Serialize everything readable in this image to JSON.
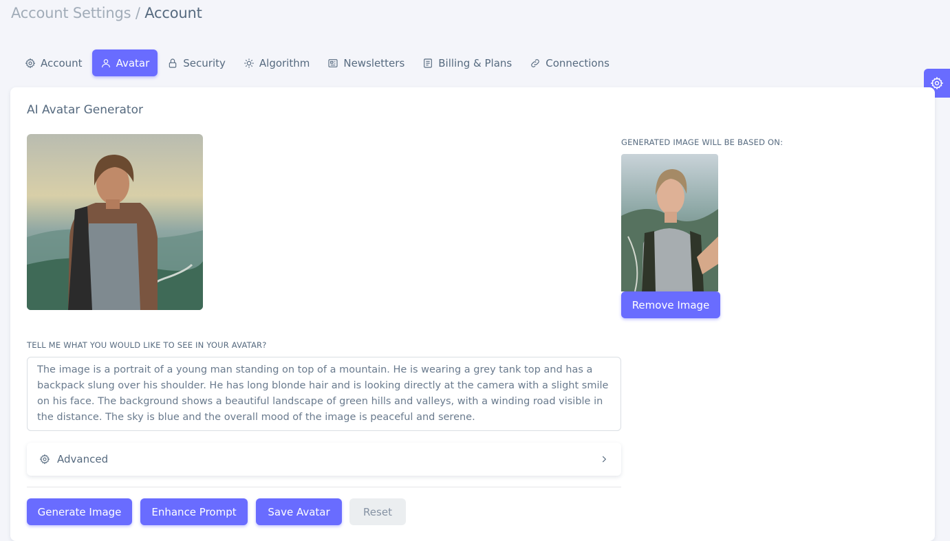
{
  "breadcrumb": {
    "parent": "Account Settings /",
    "current": "Account"
  },
  "tabs": [
    {
      "label": "Account",
      "icon": "gear-icon",
      "active": false
    },
    {
      "label": "Avatar",
      "icon": "user-icon",
      "active": true
    },
    {
      "label": "Security",
      "icon": "lock-icon",
      "active": false
    },
    {
      "label": "Algorithm",
      "icon": "cog-outline-icon",
      "active": false
    },
    {
      "label": "Newsletters",
      "icon": "newspaper-icon",
      "active": false
    },
    {
      "label": "Billing & Plans",
      "icon": "file-icon",
      "active": false
    },
    {
      "label": "Connections",
      "icon": "link-icon",
      "active": false
    }
  ],
  "card": {
    "title": "AI Avatar Generator",
    "based_on_label": "GENERATED IMAGE WILL BE BASED ON:",
    "remove_button": "Remove Image",
    "prompt_label": "TELL ME WHAT YOU WOULD LIKE TO SEE IN YOUR AVATAR?",
    "prompt_value": "The image is a portrait of a young man standing on top of a mountain. He is wearing a grey tank top and has a backpack slung over his shoulder. He has long blonde hair and is looking directly at the camera with a slight smile on his face. The background shows a beautiful landscape of green hills and valleys, with a winding road visible in the distance. The sky is blue and the overall mood of the image is peaceful and serene.",
    "advanced_label": "Advanced",
    "buttons": {
      "generate": "Generate Image",
      "enhance": "Enhance Prompt",
      "save": "Save Avatar",
      "reset": "Reset"
    }
  },
  "colors": {
    "primary": "#696cff",
    "text": "#566a7f",
    "muted": "#a1acb8",
    "background": "#f4f5fa"
  }
}
